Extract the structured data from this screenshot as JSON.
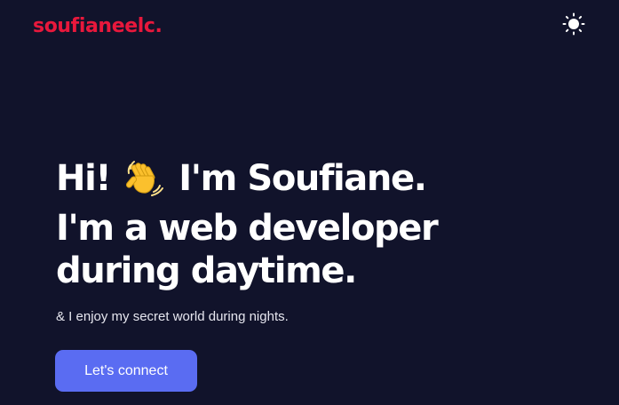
{
  "header": {
    "logo_text": "soufianeelc.",
    "theme_toggle_icon": "sun-icon"
  },
  "hero": {
    "line1_pre": "Hi!",
    "wave_icon": "waving-hand-icon",
    "line1_post": "I'm Soufiane.",
    "line2": "I'm a web developer",
    "line3": "during daytime.",
    "subtitle": "& I enjoy my secret world during nights.",
    "cta_label": "Let's connect"
  },
  "colors": {
    "background": "#11132b",
    "brand": "#e8183c",
    "accent": "#5a6cf2",
    "text": "#ffffff"
  }
}
